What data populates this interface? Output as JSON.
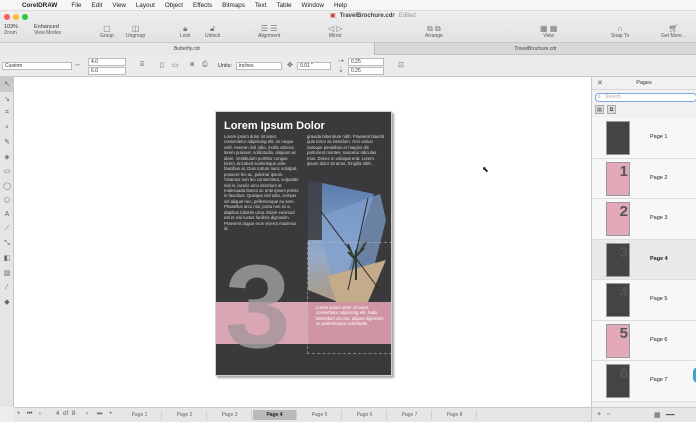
{
  "menu": {
    "app": "CorelDRAW",
    "items": [
      "File",
      "Edit",
      "View",
      "Layout",
      "Object",
      "Effects",
      "Bitmaps",
      "Text",
      "Table",
      "Window",
      "Help"
    ]
  },
  "window": {
    "title": "TravelBrochure.cdr",
    "status": "Edited"
  },
  "toolbar": {
    "zoom_value": "103%",
    "zoom_label": "Zoom",
    "view_mode_value": "Enhanced",
    "view_mode_label": "View Modes",
    "group": "Group",
    "ungroup": "Ungroup",
    "lock": "Lock",
    "unlock": "Unlock",
    "alignment": "Alignment",
    "mirror": "Mirror",
    "arrange": "Arrange",
    "view": "View",
    "snap_to": "Snap To",
    "get_more": "Get More..."
  },
  "doc_tabs": [
    "Butterfly.cdr",
    "TravelBrochure.cdr"
  ],
  "propbar": {
    "preset": "Custom",
    "width": "4.0",
    "height": "6.0",
    "units_label": "Units:",
    "units_value": "inches",
    "nudge": "0.01 \"",
    "dup_x": "0.25",
    "dup_y": "0.25"
  },
  "document": {
    "heading": "Lorem Ipsum Dolor",
    "col1": "Lorem ipsum dolor sit amet, consectetur adipiscing elit, se neque velit. Aenean nisl odio, mollis ultrices lorem pulvinar, sollicitudin, aliquam ac diam. Vestibulum porttitor congue lorem, tincidunt scelerisque ante faucibus at. Duis rutrum nunc volutpat, posuere leo ac, pulvinar ipsum. Vivamus non leo consectetur, vulputate nisl in, iaculis arcu interdum at malesuada fames ac ante ipsum primis in faucibus. Quisque nisl odio, semper vel aliquet nec, pellentesque eu sem. Phasellus arcu nisi, porta non ex a, dapibus lobortis urna. Etiam euismod est et nisi luctus facilisis dignissim. Praesent augue eros viverra maximus id.",
    "col2": "gravida bibendum nibh. Praesent blandit quis tortor ac interdum. Orci varius natoque penatibus et magnis dis parturient montes, nascetur ridiculus mus. Donec in volutpat erat. Lorem ipsum dolor sit amet, fringilla nibh.",
    "band_text": "Lorem ipsum dolor sit amet, consectetur adipiscing elit. Nulla bibendum dui nisi, aliquet dignissim ac pellentesque sollicitudin.",
    "big_number": "3"
  },
  "pager": {
    "current": "4",
    "of": "of",
    "total": "8",
    "tabs": [
      "Page 1",
      "Page 2",
      "Page 3",
      "Page 4",
      "Page 5",
      "Page 6",
      "Page 7",
      "Page 8"
    ],
    "active_index": 3
  },
  "pages_panel": {
    "title": "Pages",
    "search_placeholder": "Search",
    "pages": [
      {
        "label": "Page 1",
        "thumb": "dark",
        "num": ""
      },
      {
        "label": "Page 2",
        "thumb": "pink",
        "num": "1"
      },
      {
        "label": "Page 3",
        "thumb": "pink",
        "num": "2"
      },
      {
        "label": "Page 4",
        "thumb": "dark",
        "num": "3"
      },
      {
        "label": "Page 5",
        "thumb": "dark",
        "num": "4"
      },
      {
        "label": "Page 6",
        "thumb": "pink",
        "num": "5"
      },
      {
        "label": "Page 7",
        "thumb": "dark",
        "num": "6"
      }
    ],
    "active_index": 3
  },
  "colors": {
    "accent": "#3a8fe0",
    "page_bg": "#3a3a3c",
    "pink": "#d9a6b3",
    "number_gray": "#8d8d8f"
  }
}
